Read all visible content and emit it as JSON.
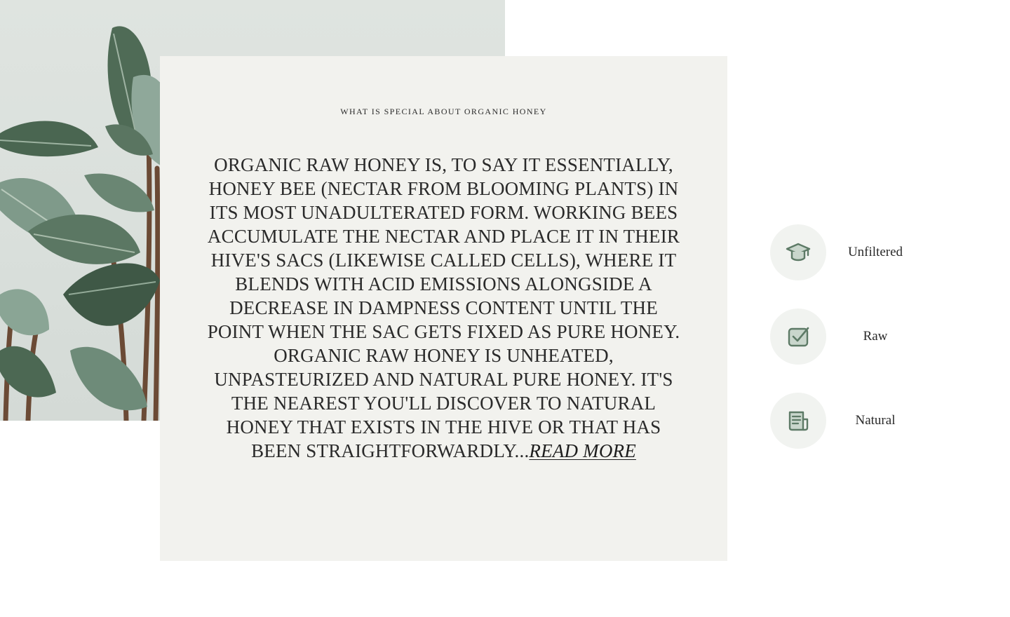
{
  "section": {
    "eyebrow": "WHAT IS SPECIAL ABOUT ORGANIC HONEY",
    "body": "Organic raw honey is, to say it essentially, honey bee (nectar from blooming plants) in its most unadulterated form. Working bees accumulate the nectar and place it in their hive's sacs (likewise called cells), where it blends with acid emissions alongside a decrease in dampness content until the point when the sac gets fixed as pure honey. Organic raw honey is unheated, unpasteurized and natural pure honey. It's the nearest you'll discover to natural honey that exists in the hive or that has been straightforwardly...",
    "read_more": "Read more"
  },
  "features": [
    {
      "label": "Unfiltered",
      "icon": "graduation-cap-icon"
    },
    {
      "label": "Raw",
      "icon": "checkbox-icon"
    },
    {
      "label": "Natural",
      "icon": "newspaper-icon"
    }
  ],
  "colors": {
    "card_background": "#f2f2ee",
    "icon_circle": "#f1f3f0",
    "icon_stroke": "#5d7a66",
    "icon_fill": "#c9d6cc"
  }
}
